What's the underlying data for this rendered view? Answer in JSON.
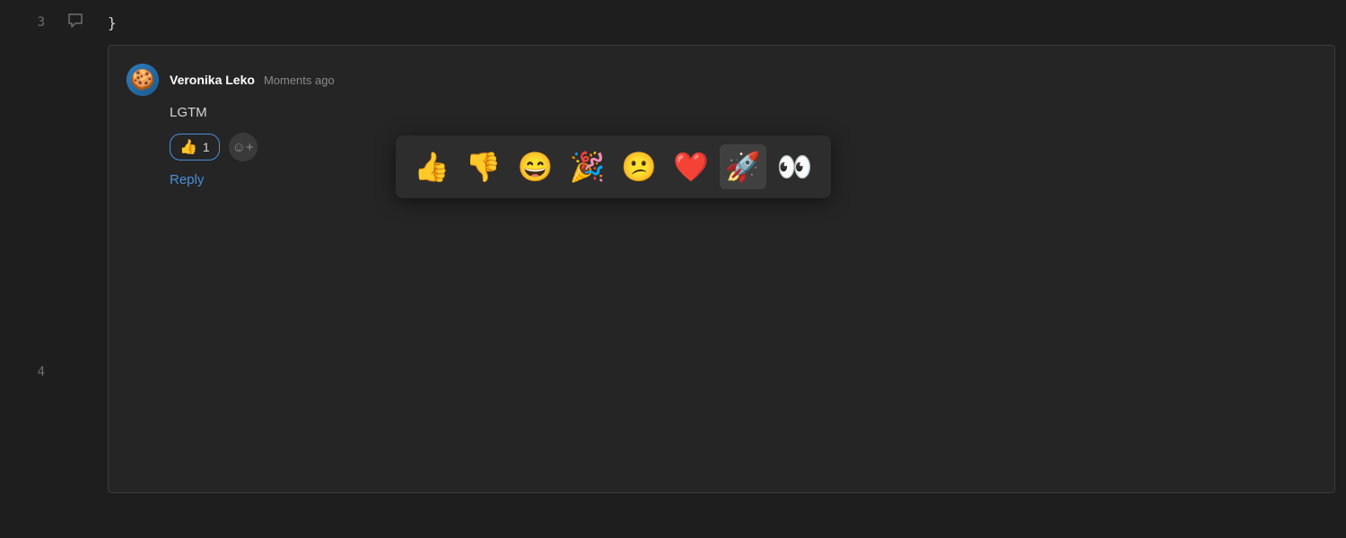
{
  "editor": {
    "lines": [
      {
        "number": "3",
        "code": "}",
        "has_comment_icon": true
      },
      {
        "number": "4",
        "code": "",
        "has_comment_icon": false
      }
    ],
    "background": "#1e1e1e"
  },
  "comment": {
    "author": "Veronika Leko",
    "timestamp": "Moments ago",
    "body": "LGTM",
    "reactions": [
      {
        "emoji": "👍",
        "count": "1",
        "selected": true
      }
    ],
    "add_reaction_label": "😊+",
    "reply_label": "Reply"
  },
  "emoji_picker": {
    "emojis": [
      {
        "symbol": "👍",
        "name": "thumbs-up"
      },
      {
        "symbol": "👎",
        "name": "thumbs-down"
      },
      {
        "symbol": "😄",
        "name": "grinning"
      },
      {
        "symbol": "🎉",
        "name": "party"
      },
      {
        "symbol": "😕",
        "name": "confused"
      },
      {
        "symbol": "❤️",
        "name": "heart"
      },
      {
        "symbol": "🚀",
        "name": "rocket"
      },
      {
        "symbol": "👀",
        "name": "eyes"
      }
    ],
    "selected": "rocket"
  },
  "colors": {
    "background": "#1e1e1e",
    "panel_bg": "#252526",
    "accent": "#4a90d9",
    "text_primary": "#ffffff",
    "text_secondary": "#8a8a8a",
    "text_code": "#d4d4d4",
    "gutter_text": "#6e6e6e",
    "picker_bg": "#2d2d2d",
    "picker_selected": "#404040"
  }
}
